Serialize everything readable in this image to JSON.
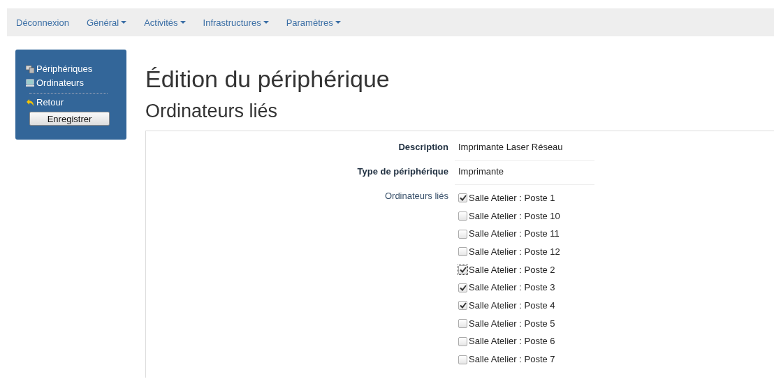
{
  "navbar": {
    "items": [
      {
        "label": "Déconnexion",
        "dropdown": false
      },
      {
        "label": "Général",
        "dropdown": true
      },
      {
        "label": "Activités",
        "dropdown": true
      },
      {
        "label": "Infrastructures",
        "dropdown": true
      },
      {
        "label": "Paramètres",
        "dropdown": true
      }
    ]
  },
  "sidebar": {
    "links": [
      {
        "label": "Périphériques",
        "kind": "devices"
      },
      {
        "label": "Ordinateurs",
        "kind": "computer"
      }
    ],
    "back": {
      "label": "Retour"
    },
    "save_button": "Enregistrer"
  },
  "page_title": "Édition du périphérique",
  "section_title": "Ordinateurs liés",
  "form": {
    "fields": [
      {
        "label": "Description",
        "value": "Imprimante Laser Réseau"
      },
      {
        "label": "Type de périphérique",
        "value": "Imprimante"
      }
    ],
    "computers": {
      "label": "Ordinateurs liés",
      "options": [
        {
          "label": "Salle Atelier : Poste 1",
          "checked": true,
          "focused": false
        },
        {
          "label": "Salle Atelier : Poste 10",
          "checked": false,
          "focused": false
        },
        {
          "label": "Salle Atelier : Poste 11",
          "checked": false,
          "focused": false
        },
        {
          "label": "Salle Atelier : Poste 12",
          "checked": false,
          "focused": false
        },
        {
          "label": "Salle Atelier : Poste 2",
          "checked": true,
          "focused": true
        },
        {
          "label": "Salle Atelier : Poste 3",
          "checked": true,
          "focused": false
        },
        {
          "label": "Salle Atelier : Poste 4",
          "checked": true,
          "focused": false
        },
        {
          "label": "Salle Atelier : Poste 5",
          "checked": false,
          "focused": false
        },
        {
          "label": "Salle Atelier : Poste 6",
          "checked": false,
          "focused": false
        },
        {
          "label": "Salle Atelier : Poste 7",
          "checked": false,
          "focused": false
        }
      ]
    }
  }
}
